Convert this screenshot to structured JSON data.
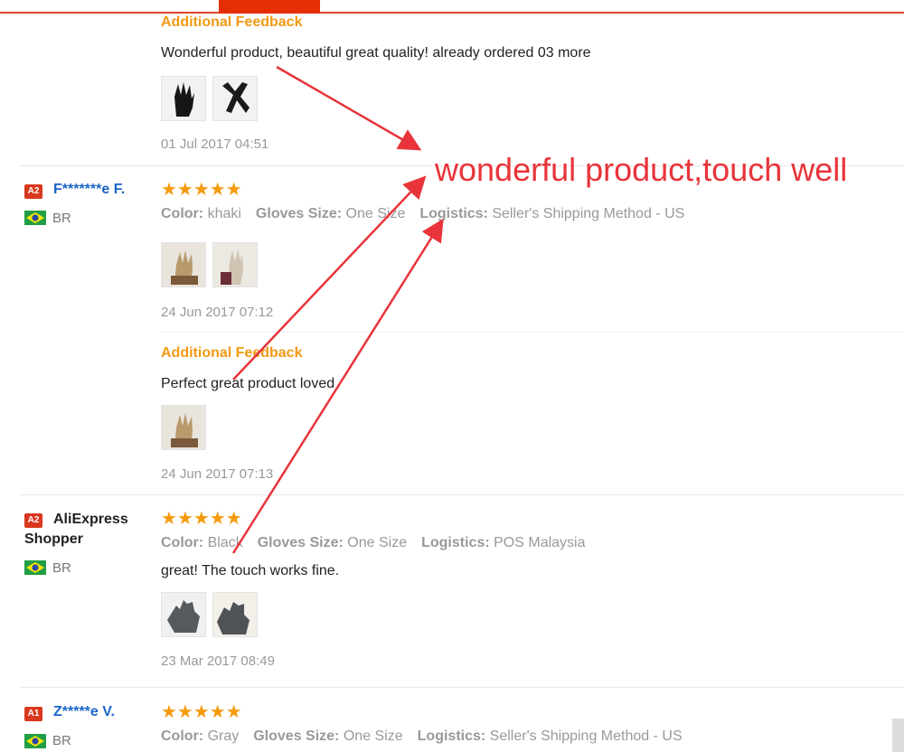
{
  "annotation": "wonderful product,touch well",
  "reviews": [
    {
      "additional_feedback_label": "Additional Feedback",
      "additional_text": "Wonderful product, beautiful great quality! already ordered 03 more",
      "additional_date": "01 Jul 2017 04:51",
      "thumbs": [
        "black-glove",
        "black-glove"
      ]
    },
    {
      "badge": "A2",
      "name": "F*******e F.",
      "country": "BR",
      "stars": "★★★★★",
      "color_label": "Color:",
      "color_value": "khaki",
      "size_label": "Gloves Size:",
      "size_value": "One Size",
      "logistics_label": "Logistics:",
      "logistics_value": "Seller's Shipping Method - US",
      "date": "24 Jun 2017 07:12",
      "additional_feedback_label": "Additional Feedback",
      "additional_text": "Perfect great product loved",
      "additional_date": "24 Jun 2017 07:13"
    },
    {
      "badge": "A2",
      "name_line1": "AliExpress",
      "name_line2": "Shopper",
      "country": "BR",
      "stars": "★★★★★",
      "color_label": "Color:",
      "color_value": "Black",
      "size_label": "Gloves Size:",
      "size_value": "One Size",
      "logistics_label": "Logistics:",
      "logistics_value": "POS Malaysia",
      "text": "great! The touch works fine.",
      "date": "23 Mar 2017 08:49"
    },
    {
      "badge": "A1",
      "name": "Z*****e V.",
      "country": "BR",
      "stars": "★★★★★",
      "color_label": "Color:",
      "color_value": "Gray",
      "size_label": "Gloves Size:",
      "size_value": "One Size",
      "logistics_label": "Logistics:",
      "logistics_value": "Seller's Shipping Method - US"
    }
  ],
  "colors": {
    "accent": "#e62e04",
    "star": "#f59a0c",
    "feedback_label": "#f29a14",
    "annotation": "#e8343a",
    "name_link": "#1a66c7"
  }
}
